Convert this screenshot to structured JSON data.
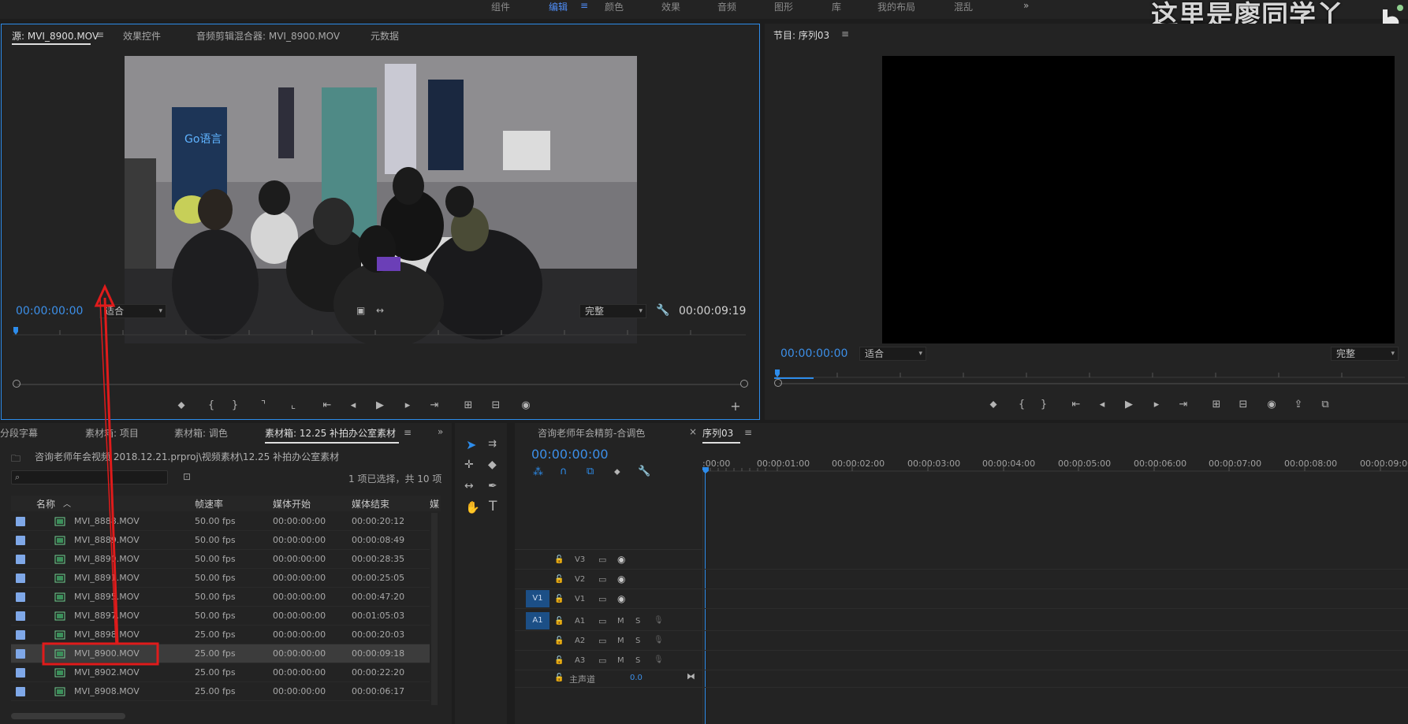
{
  "workspace_tabs": [
    "组件",
    "编辑",
    "颜色",
    "效果",
    "音频",
    "图形",
    "库",
    "我的布局",
    "混乱"
  ],
  "workspace_active": "编辑",
  "overlay_text": "这里是廖同学丫",
  "source_panel": {
    "tabs": [
      "源: MVI_8900.MOV",
      "效果控件",
      "音频剪辑混合器: MVI_8900.MOV",
      "元数据"
    ],
    "timecode_in": "00:00:00:00",
    "fit": "适合",
    "quality": "完整",
    "duration": "00:00:09:19"
  },
  "program_panel": {
    "title": "节目: 序列03",
    "timecode": "00:00:00:00",
    "fit": "适合",
    "quality": "完整"
  },
  "project_panel": {
    "tabs": [
      "分段字幕",
      "素材箱: 项目",
      "素材箱: 调色",
      "素材箱: 12.25 补拍办公室素材"
    ],
    "path": "咨询老师年会视频 2018.12.21.prproj\\视频素材\\12.25 补拍办公室素材",
    "selection_info": "1 项已选择，共 10 项",
    "columns": [
      "名称",
      "帧速率",
      "媒体开始",
      "媒体结束",
      "媒"
    ],
    "rows": [
      {
        "name": "MVI_8888.MOV",
        "fps": "50.00 fps",
        "start": "00:00:00:00",
        "end": "00:00:20:12"
      },
      {
        "name": "MVI_8889.MOV",
        "fps": "50.00 fps",
        "start": "00:00:00:00",
        "end": "00:00:08:49"
      },
      {
        "name": "MVI_8890.MOV",
        "fps": "50.00 fps",
        "start": "00:00:00:00",
        "end": "00:00:28:35"
      },
      {
        "name": "MVI_8891.MOV",
        "fps": "50.00 fps",
        "start": "00:00:00:00",
        "end": "00:00:25:05"
      },
      {
        "name": "MVI_8895.MOV",
        "fps": "50.00 fps",
        "start": "00:00:00:00",
        "end": "00:00:47:20"
      },
      {
        "name": "MVI_8897.MOV",
        "fps": "50.00 fps",
        "start": "00:00:00:00",
        "end": "00:01:05:03"
      },
      {
        "name": "MVI_8898.MOV",
        "fps": "25.00 fps",
        "start": "00:00:00:00",
        "end": "00:00:20:03"
      },
      {
        "name": "MVI_8900.MOV",
        "fps": "25.00 fps",
        "start": "00:00:00:00",
        "end": "00:00:09:18"
      },
      {
        "name": "MVI_8902.MOV",
        "fps": "25.00 fps",
        "start": "00:00:00:00",
        "end": "00:00:22:20"
      },
      {
        "name": "MVI_8908.MOV",
        "fps": "25.00 fps",
        "start": "00:00:00:00",
        "end": "00:00:06:17"
      }
    ],
    "selected_index": 7
  },
  "timeline_panel": {
    "tabs": [
      "咨询老师年会精剪-合调色",
      "序列03"
    ],
    "timecode": "00:00:00:00",
    "ruler": [
      ":00:00",
      "00:00:01:00",
      "00:00:02:00",
      "00:00:03:00",
      "00:00:04:00",
      "00:00:05:00",
      "00:00:06:00",
      "00:00:07:00",
      "00:00:08:00",
      "00:00:09:00"
    ],
    "video_tracks": [
      "V3",
      "V2",
      "V1"
    ],
    "audio_tracks": [
      "A1",
      "A2",
      "A3"
    ],
    "target_video": "V1",
    "target_audio": "A1",
    "master_label": "主声道",
    "master_value": "0.0"
  },
  "colors": {
    "accent_blue": "#2d8ceb",
    "timecode_blue": "#3c8fe8",
    "annotation_red": "#e01b1b"
  }
}
